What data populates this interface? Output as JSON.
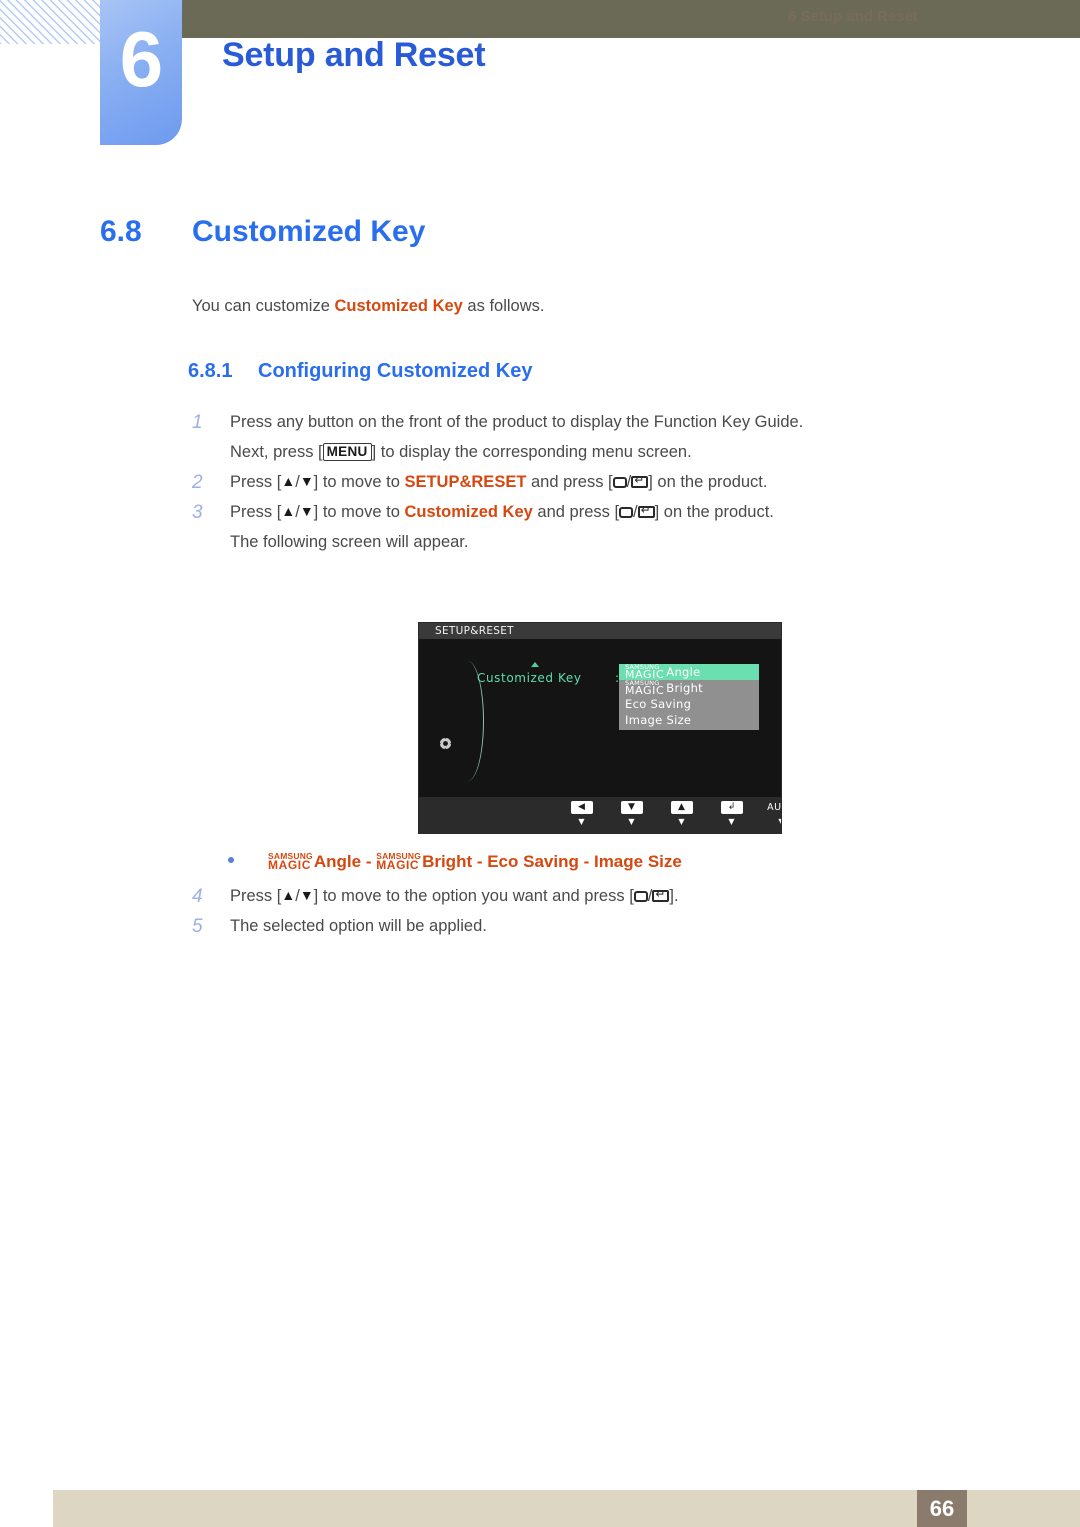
{
  "header": {
    "chapter_number": "6",
    "chapter_title": "Setup and Reset"
  },
  "section": {
    "number": "6.8",
    "title": "Customized Key",
    "intro_before": "You can customize ",
    "intro_highlight": "Customized Key",
    "intro_after": " as follows."
  },
  "subsection": {
    "number": "6.8.1",
    "title": "Configuring Customized Key"
  },
  "steps": [
    {
      "index": "1",
      "parts": [
        {
          "type": "text",
          "value": "Press any button on the front of the product to display the Function Key Guide."
        }
      ]
    },
    {
      "index": "",
      "parts": [
        {
          "type": "text",
          "value": "Next, press ["
        },
        {
          "type": "keycap",
          "value": "MENU"
        },
        {
          "type": "text",
          "value": "] to display the corresponding menu screen."
        }
      ]
    },
    {
      "index": "2",
      "parts": [
        {
          "type": "text",
          "value": "Press ["
        },
        {
          "type": "glyph",
          "value": "▲"
        },
        {
          "type": "text",
          "value": "/"
        },
        {
          "type": "glyph",
          "value": "▼"
        },
        {
          "type": "text",
          "value": "] to move to "
        },
        {
          "type": "highlight",
          "value": "SETUP&RESET"
        },
        {
          "type": "text",
          "value": " and press ["
        },
        {
          "type": "icon",
          "value": "rounded-box-icon"
        },
        {
          "type": "text",
          "value": "/"
        },
        {
          "type": "icon",
          "value": "enter-key-icon"
        },
        {
          "type": "text",
          "value": "] on the product."
        }
      ]
    },
    {
      "index": "3",
      "parts": [
        {
          "type": "text",
          "value": "Press ["
        },
        {
          "type": "glyph",
          "value": "▲"
        },
        {
          "type": "text",
          "value": "/"
        },
        {
          "type": "glyph",
          "value": "▼"
        },
        {
          "type": "text",
          "value": "] to move to "
        },
        {
          "type": "highlight",
          "value": "Customized Key"
        },
        {
          "type": "text",
          "value": " and press ["
        },
        {
          "type": "icon",
          "value": "rounded-box-icon"
        },
        {
          "type": "text",
          "value": "/"
        },
        {
          "type": "icon",
          "value": "enter-key-icon"
        },
        {
          "type": "text",
          "value": "] on the product."
        }
      ]
    },
    {
      "index": "",
      "parts": [
        {
          "type": "text",
          "value": "The following screen will appear."
        }
      ]
    }
  ],
  "steps_after": [
    {
      "index": "4",
      "parts": [
        {
          "type": "text",
          "value": "Press ["
        },
        {
          "type": "glyph",
          "value": "▲"
        },
        {
          "type": "text",
          "value": "/"
        },
        {
          "type": "glyph",
          "value": "▼"
        },
        {
          "type": "text",
          "value": "] to move to the option you want and press ["
        },
        {
          "type": "icon",
          "value": "rounded-box-icon"
        },
        {
          "type": "text",
          "value": "/"
        },
        {
          "type": "icon",
          "value": "enter-key-icon"
        },
        {
          "type": "text",
          "value": "]."
        }
      ]
    },
    {
      "index": "5",
      "parts": [
        {
          "type": "text",
          "value": "The selected option will be applied."
        }
      ]
    }
  ],
  "bullet_line": {
    "magic_top": "SAMSUNG",
    "magic_bottom": "MAGIC",
    "item1": "Angle",
    "sep1": " - ",
    "item2": "Bright",
    "sep2": " - ",
    "item3": "Eco Saving",
    "sep3": " - ",
    "item4": "Image Size"
  },
  "osd": {
    "title": "SETUP&RESET",
    "label": "Customized Key",
    "colon": ":",
    "magic_top": "SAMSUNG",
    "magic_bottom": "MAGIC",
    "options": [
      {
        "magic": true,
        "text": "Angle",
        "selected": true
      },
      {
        "magic": true,
        "text": "Bright",
        "selected": false
      },
      {
        "magic": false,
        "text": "Eco Saving",
        "selected": false
      },
      {
        "magic": false,
        "text": "Image Size",
        "selected": false
      }
    ],
    "buttons": [
      {
        "glyph": "◀",
        "boxed": true,
        "name": "left-button"
      },
      {
        "glyph": "▼",
        "boxed": true,
        "name": "down-button"
      },
      {
        "glyph": "▲",
        "boxed": true,
        "name": "up-button"
      },
      {
        "glyph": "↲",
        "boxed": true,
        "name": "enter-button"
      },
      {
        "glyph": "AUTO",
        "boxed": false,
        "name": "auto-button"
      },
      {
        "glyph": "⏻",
        "boxed": false,
        "name": "power-button"
      }
    ],
    "button_hint": "▼"
  },
  "footer": {
    "text": "6 Setup and Reset",
    "page": "66"
  },
  "colors": {
    "heading_blue": "#2a6ef0",
    "chapter_blue": "#2a5bd7",
    "highlight_orange": "#d6480f",
    "olive": "#6b6a56",
    "footer_beige": "#dcd6c2",
    "footer_page_brown": "#8a7b6c",
    "osd_mint": "#6bdfb0",
    "osd_label_mint": "#5fddab",
    "osd_panel_gray": "#909090",
    "step_index_blue": "#9dafe6"
  }
}
